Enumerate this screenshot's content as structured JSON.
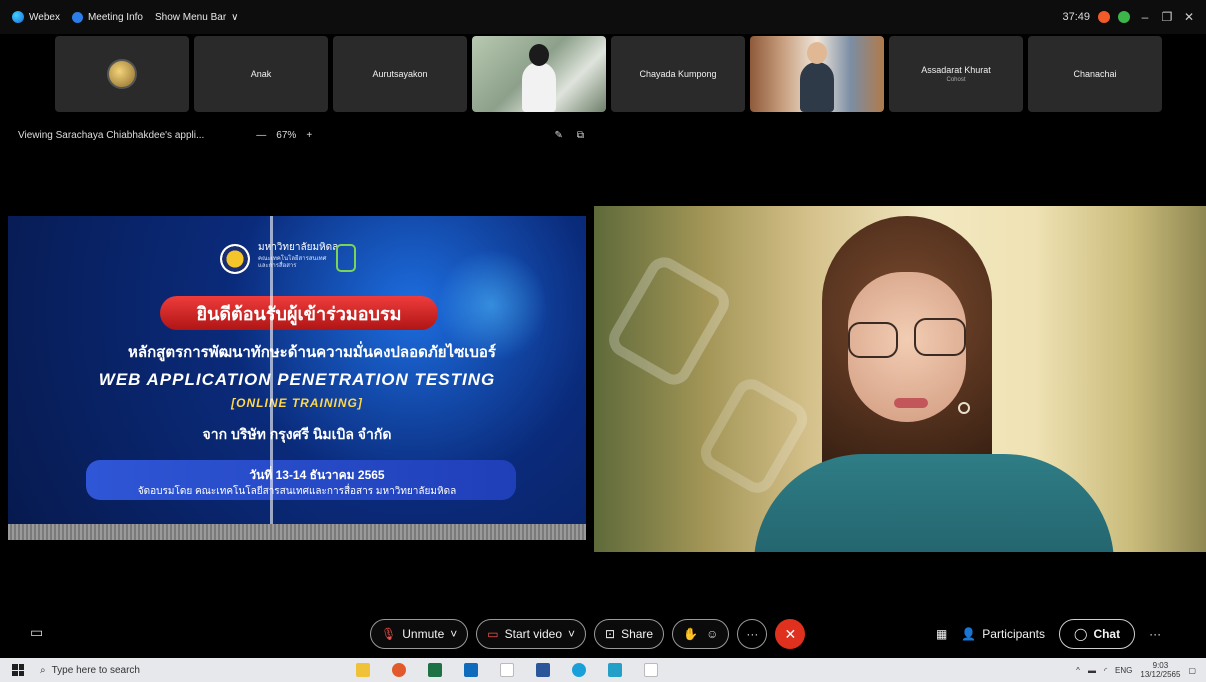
{
  "topbar": {
    "app_name": "Webex",
    "meeting_info": "Meeting Info",
    "show_menu_bar": "Show Menu Bar",
    "chevron": "∨",
    "timer": "37:49",
    "minimize": "–",
    "restore": "❐",
    "close": "✕"
  },
  "participants": [
    {
      "name": ""
    },
    {
      "name": "Anak"
    },
    {
      "name": "Aurutsayakon"
    },
    {
      "name": ""
    },
    {
      "name": "Chayada Kumpong"
    },
    {
      "name": ""
    },
    {
      "name": "Assadarat Khurat",
      "role": "Cohost"
    },
    {
      "name": "Chanachai"
    }
  ],
  "share": {
    "viewing": "Viewing Sarachaya Chiabhakdee's appli...",
    "zoom_out": "—",
    "zoom_level": "67%",
    "zoom_in": "+"
  },
  "slide": {
    "uni_name": "มหาวิทยาลัยมหิดล",
    "uni_sub": "คณะเทคโนโลยีสารสนเทศและการสื่อสาร",
    "welcome": "ยินดีต้อนรับผู้เข้าร่วมอบรม",
    "line1": "หลักสูตรการพัฒนาทักษะด้านความมั่นคงปลอดภัยไซเบอร์",
    "line2": "WEB APPLICATION PENETRATION TESTING",
    "line3": "[ONLINE TRAINING]",
    "line4": "จาก บริษัท กรุงศรี นิมเบิล จำกัด",
    "date": "วันที่ 13-14 ธันวาคม 2565",
    "org": "จัดอบรมโดย คณะเทคโนโลยีสารสนเทศและการสื่อสาร มหาวิทยาลัยมหิดล"
  },
  "controls": {
    "unmute": "Unmute",
    "start_video": "Start video",
    "share": "Share",
    "participants": "Participants",
    "chat": "Chat",
    "more": "···"
  },
  "taskbar": {
    "search_placeholder": "Type here to search",
    "lang": "ENG",
    "time": "9:03",
    "date": "13/12/2565"
  }
}
